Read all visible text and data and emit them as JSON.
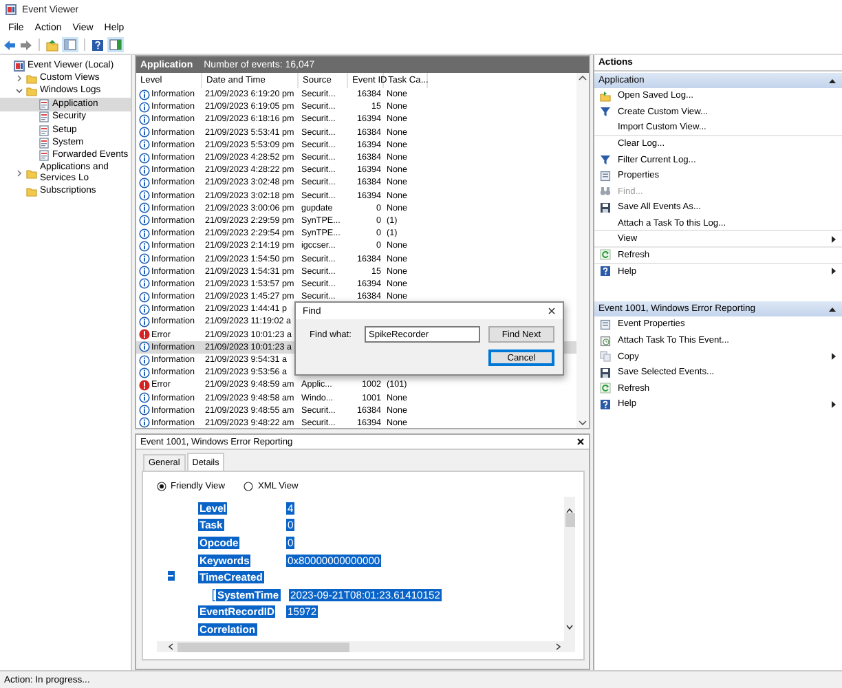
{
  "window": {
    "title": "Event Viewer"
  },
  "menu": [
    "File",
    "Action",
    "View",
    "Help"
  ],
  "tree": [
    {
      "label": "Event Viewer (Local)",
      "kind": "root",
      "selected": false,
      "children": [
        {
          "label": "Custom Views",
          "kind": "folder",
          "expanded": false,
          "selected": false
        },
        {
          "label": "Windows Logs",
          "kind": "folder",
          "expanded": true,
          "selected": false,
          "children": [
            {
              "label": "Application",
              "kind": "log",
              "selected": true
            },
            {
              "label": "Security",
              "kind": "log",
              "selected": false
            },
            {
              "label": "Setup",
              "kind": "log",
              "selected": false
            },
            {
              "label": "System",
              "kind": "log",
              "selected": false
            },
            {
              "label": "Forwarded Events",
              "kind": "log",
              "selected": false
            }
          ]
        },
        {
          "label": "Applications and Services Lo",
          "kind": "folder",
          "expanded": false,
          "selected": false
        },
        {
          "label": "Subscriptions",
          "kind": "folder",
          "selected": false
        }
      ]
    }
  ],
  "log_header": {
    "title": "Application",
    "count": "Number of events: 16,047"
  },
  "table": {
    "columns": [
      "Level",
      "Date and Time",
      "Source",
      "Event ID",
      "Task Ca..."
    ],
    "rows": [
      {
        "kind": "info",
        "level": "Information",
        "date": "21/09/2023 6:19:20 pm",
        "source": "Securit...",
        "event_id": "16384",
        "task": "None",
        "selected": false
      },
      {
        "kind": "info",
        "level": "Information",
        "date": "21/09/2023 6:19:05 pm",
        "source": "Securit...",
        "event_id": "15",
        "task": "None",
        "selected": false
      },
      {
        "kind": "info",
        "level": "Information",
        "date": "21/09/2023 6:18:16 pm",
        "source": "Securit...",
        "event_id": "16394",
        "task": "None",
        "selected": false
      },
      {
        "kind": "info",
        "level": "Information",
        "date": "21/09/2023 5:53:41 pm",
        "source": "Securit...",
        "event_id": "16384",
        "task": "None",
        "selected": false
      },
      {
        "kind": "info",
        "level": "Information",
        "date": "21/09/2023 5:53:09 pm",
        "source": "Securit...",
        "event_id": "16394",
        "task": "None",
        "selected": false
      },
      {
        "kind": "info",
        "level": "Information",
        "date": "21/09/2023 4:28:52 pm",
        "source": "Securit...",
        "event_id": "16384",
        "task": "None",
        "selected": false
      },
      {
        "kind": "info",
        "level": "Information",
        "date": "21/09/2023 4:28:22 pm",
        "source": "Securit...",
        "event_id": "16394",
        "task": "None",
        "selected": false
      },
      {
        "kind": "info",
        "level": "Information",
        "date": "21/09/2023 3:02:48 pm",
        "source": "Securit...",
        "event_id": "16384",
        "task": "None",
        "selected": false
      },
      {
        "kind": "info",
        "level": "Information",
        "date": "21/09/2023 3:02:18 pm",
        "source": "Securit...",
        "event_id": "16394",
        "task": "None",
        "selected": false
      },
      {
        "kind": "info",
        "level": "Information",
        "date": "21/09/2023 3:00:06 pm",
        "source": "gupdate",
        "event_id": "0",
        "task": "None",
        "selected": false
      },
      {
        "kind": "info",
        "level": "Information",
        "date": "21/09/2023 2:29:59 pm",
        "source": "SynTPE...",
        "event_id": "0",
        "task": "(1)",
        "selected": false
      },
      {
        "kind": "info",
        "level": "Information",
        "date": "21/09/2023 2:29:54 pm",
        "source": "SynTPE...",
        "event_id": "0",
        "task": "(1)",
        "selected": false
      },
      {
        "kind": "info",
        "level": "Information",
        "date": "21/09/2023 2:14:19 pm",
        "source": "igccser...",
        "event_id": "0",
        "task": "None",
        "selected": false
      },
      {
        "kind": "info",
        "level": "Information",
        "date": "21/09/2023 1:54:50 pm",
        "source": "Securit...",
        "event_id": "16384",
        "task": "None",
        "selected": false
      },
      {
        "kind": "info",
        "level": "Information",
        "date": "21/09/2023 1:54:31 pm",
        "source": "Securit...",
        "event_id": "15",
        "task": "None",
        "selected": false
      },
      {
        "kind": "info",
        "level": "Information",
        "date": "21/09/2023 1:53:57 pm",
        "source": "Securit...",
        "event_id": "16394",
        "task": "None",
        "selected": false
      },
      {
        "kind": "info",
        "level": "Information",
        "date": "21/09/2023 1:45:27 pm",
        "source": "Securit...",
        "event_id": "16384",
        "task": "None",
        "selected": false
      },
      {
        "kind": "info",
        "level": "Information",
        "date": "21/09/2023 1:44:41 p",
        "selected": false
      },
      {
        "kind": "info",
        "level": "Information",
        "date": "21/09/2023 11:19:02 a",
        "selected": false
      },
      {
        "kind": "error",
        "level": "Error",
        "date": "21/09/2023 10:01:23 a",
        "selected": false
      },
      {
        "kind": "info",
        "level": "Information",
        "date": "21/09/2023 10:01:23 a",
        "selected": true
      },
      {
        "kind": "info",
        "level": "Information",
        "date": "21/09/2023 9:54:31 a",
        "selected": false
      },
      {
        "kind": "info",
        "level": "Information",
        "date": "21/09/2023 9:53:56 a",
        "selected": false
      },
      {
        "kind": "error",
        "level": "Error",
        "date": "21/09/2023 9:48:59 am",
        "source": "Applic...",
        "event_id": "1002",
        "task": "(101)",
        "selected": false
      },
      {
        "kind": "info",
        "level": "Information",
        "date": "21/09/2023 9:48:58 am",
        "source": "Windo...",
        "event_id": "1001",
        "task": "None",
        "selected": false
      },
      {
        "kind": "info",
        "level": "Information",
        "date": "21/09/2023 9:48:55 am",
        "source": "Securit...",
        "event_id": "16384",
        "task": "None",
        "selected": false
      },
      {
        "kind": "info",
        "level": "Information",
        "date": "21/09/2023 9:48:22 am",
        "source": "Securit...",
        "event_id": "16394",
        "task": "None",
        "selected": false
      }
    ]
  },
  "find_dialog": {
    "title": "Find",
    "label": "Find what:",
    "value": "SpikeRecorder",
    "buttons": [
      {
        "label": "Find Next",
        "default": false
      },
      {
        "label": "Cancel",
        "default": true
      }
    ]
  },
  "details": {
    "title": "Event 1001, Windows Error Reporting",
    "tabs": [
      {
        "label": "General",
        "selected": false
      },
      {
        "label": "Details",
        "selected": true
      }
    ],
    "views": [
      {
        "label": "Friendly View",
        "selected": true
      },
      {
        "label": "XML View",
        "selected": false
      }
    ],
    "lines": [
      {
        "key": "Level",
        "value": "4"
      },
      {
        "key": "Task",
        "value": "0"
      },
      {
        "key": "Opcode",
        "value": "0"
      },
      {
        "key": "Keywords",
        "value": "0x80000000000000"
      },
      {
        "key": "TimeCreated",
        "expanded": true,
        "children": [
          {
            "key": "SystemTime",
            "value": "2023-09-21T08:01:23.61410152"
          }
        ]
      },
      {
        "key": "EventRecordID",
        "value": "15972"
      },
      {
        "key": "Correlation"
      }
    ]
  },
  "actions": {
    "title": "Actions",
    "sections": [
      {
        "title": "Application",
        "expanded": true,
        "items": [
          {
            "label": "Open Saved Log...",
            "disabled": false,
            "submenu": false,
            "divider": false
          },
          {
            "label": "Create Custom View...",
            "disabled": false,
            "submenu": false,
            "divider": false
          },
          {
            "label": "Import Custom View...",
            "disabled": false,
            "submenu": false,
            "divider": true
          },
          {
            "label": "Clear Log...",
            "disabled": false,
            "submenu": false,
            "divider": false
          },
          {
            "label": "Filter Current Log...",
            "disabled": false,
            "submenu": false,
            "divider": false
          },
          {
            "label": "Properties",
            "disabled": false,
            "submenu": false,
            "divider": false
          },
          {
            "label": "Find...",
            "disabled": true,
            "submenu": false,
            "divider": false
          },
          {
            "label": "Save All Events As...",
            "disabled": false,
            "submenu": false,
            "divider": false
          },
          {
            "label": "Attach a Task To this Log...",
            "disabled": false,
            "submenu": false,
            "divider": true
          },
          {
            "label": "View",
            "disabled": false,
            "submenu": true,
            "divider": true
          },
          {
            "label": "Refresh",
            "disabled": false,
            "submenu": false,
            "divider": true
          },
          {
            "label": "Help",
            "disabled": false,
            "submenu": true,
            "divider": false
          }
        ]
      },
      {
        "title": "Event 1001, Windows Error Reporting",
        "expanded": true,
        "items": [
          {
            "label": "Event Properties",
            "disabled": false,
            "submenu": false,
            "divider": false
          },
          {
            "label": "Attach Task To This Event...",
            "disabled": false,
            "submenu": false,
            "divider": false
          },
          {
            "label": "Copy",
            "disabled": false,
            "submenu": true,
            "divider": false
          },
          {
            "label": "Save Selected Events...",
            "disabled": false,
            "submenu": false,
            "divider": false
          },
          {
            "label": "Refresh",
            "disabled": false,
            "submenu": false,
            "divider": false
          },
          {
            "label": "Help",
            "disabled": false,
            "submenu": true,
            "divider": false
          }
        ]
      }
    ]
  },
  "status_bar": "Action: In progress..."
}
